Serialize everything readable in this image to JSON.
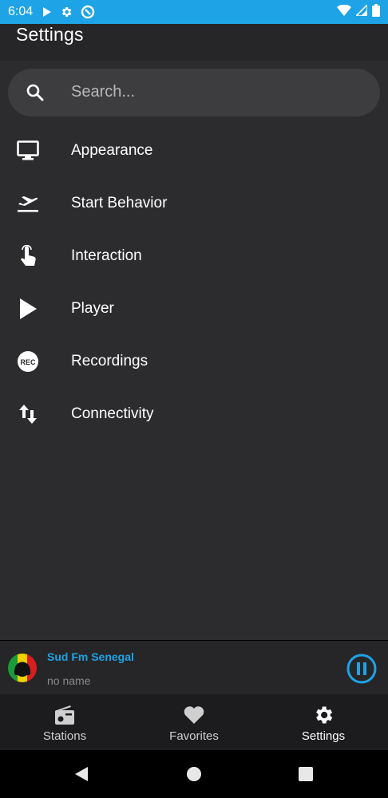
{
  "status_bar": {
    "time": "6:04"
  },
  "header": {
    "title": "Settings"
  },
  "search": {
    "placeholder": "Search..."
  },
  "menu": {
    "items": [
      {
        "label": "Appearance",
        "icon": "monitor-icon"
      },
      {
        "label": "Start Behavior",
        "icon": "flight-takeoff-icon"
      },
      {
        "label": "Interaction",
        "icon": "touch-hand-icon"
      },
      {
        "label": "Player",
        "icon": "play-icon"
      },
      {
        "label": "Recordings",
        "icon": "rec-icon",
        "badge": "REC"
      },
      {
        "label": "Connectivity",
        "icon": "swap-vertical-icon"
      }
    ]
  },
  "mini_player": {
    "station": "Sud Fm Senegal",
    "subtitle": "no name"
  },
  "bottom_nav": {
    "items": [
      {
        "label": "Stations",
        "icon": "radio-icon"
      },
      {
        "label": "Favorites",
        "icon": "heart-icon"
      },
      {
        "label": "Settings",
        "icon": "gear-icon"
      }
    ],
    "active": "Settings"
  },
  "colors": {
    "accent": "#1ea3e6",
    "background": "#2c2c2e"
  }
}
